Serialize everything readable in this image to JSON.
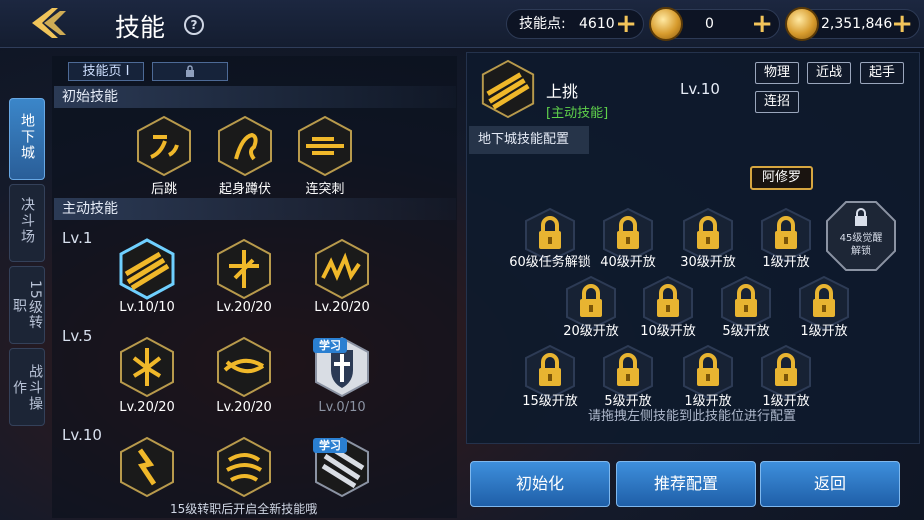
{
  "header": {
    "title": "技能",
    "help_label": "?",
    "skill_points_label": "技能点:",
    "skill_points_value": "4610",
    "coin_value": "0",
    "gold_value": "2,351,846",
    "plus_label": "+"
  },
  "sidebar": {
    "tabs": [
      {
        "label": "地下城",
        "active": true
      },
      {
        "label": "决斗场",
        "active": false
      },
      {
        "label": "15级转职",
        "active": false
      },
      {
        "label": "战斗操作",
        "active": false
      }
    ]
  },
  "left": {
    "page_tab_label": "技能页 I",
    "lock_icon": "lock-icon",
    "initial_section": "初始技能",
    "active_section": "主动技能",
    "initial_skills": [
      {
        "name": "后跳"
      },
      {
        "name": "起身蹲伏"
      },
      {
        "name": "连突刺"
      }
    ],
    "level_groups": [
      {
        "level_label": "Lv.1",
        "skills": [
          {
            "level": "Lv.10/10",
            "selected": true
          },
          {
            "level": "Lv.20/20"
          },
          {
            "level": "Lv.20/20"
          }
        ]
      },
      {
        "level_label": "Lv.5",
        "skills": [
          {
            "level": "Lv.20/20"
          },
          {
            "level": "Lv.20/20"
          },
          {
            "level": "Lv.0/10",
            "learn_badge": "学习"
          }
        ]
      },
      {
        "level_label": "Lv.10",
        "skills": [
          {
            "level": ""
          },
          {
            "level": ""
          },
          {
            "level": "",
            "learn_badge": "学习"
          }
        ]
      }
    ],
    "hint": "15级转职后开启全新技能哦"
  },
  "right": {
    "selected_skill": {
      "name": "上挑",
      "type": "[主动技能]",
      "level": "Lv.10",
      "tags": [
        "物理",
        "近战",
        "起手",
        "连招"
      ]
    },
    "config_title": "地下城技能配置",
    "hero_label": "阿修罗",
    "slots_row1": [
      "60级任务解锁",
      "40级开放",
      "30级开放",
      "1级开放"
    ],
    "slots_row2": [
      "20级开放",
      "10级开放",
      "5级开放",
      "1级开放"
    ],
    "slots_row3": [
      "15级开放",
      "5级开放",
      "1级开放",
      "1级开放"
    ],
    "awaken_label_1": "45级觉醒",
    "awaken_label_2": "解锁",
    "drag_hint": "请拖拽左侧技能到此技能位进行配置"
  },
  "buttons": {
    "reset": "初始化",
    "recommend": "推荐配置",
    "back": "返回"
  },
  "colors": {
    "accent_blue": "#2a7fd1",
    "gold": "#f3c55a",
    "active_type_green": "#5fd14b"
  }
}
